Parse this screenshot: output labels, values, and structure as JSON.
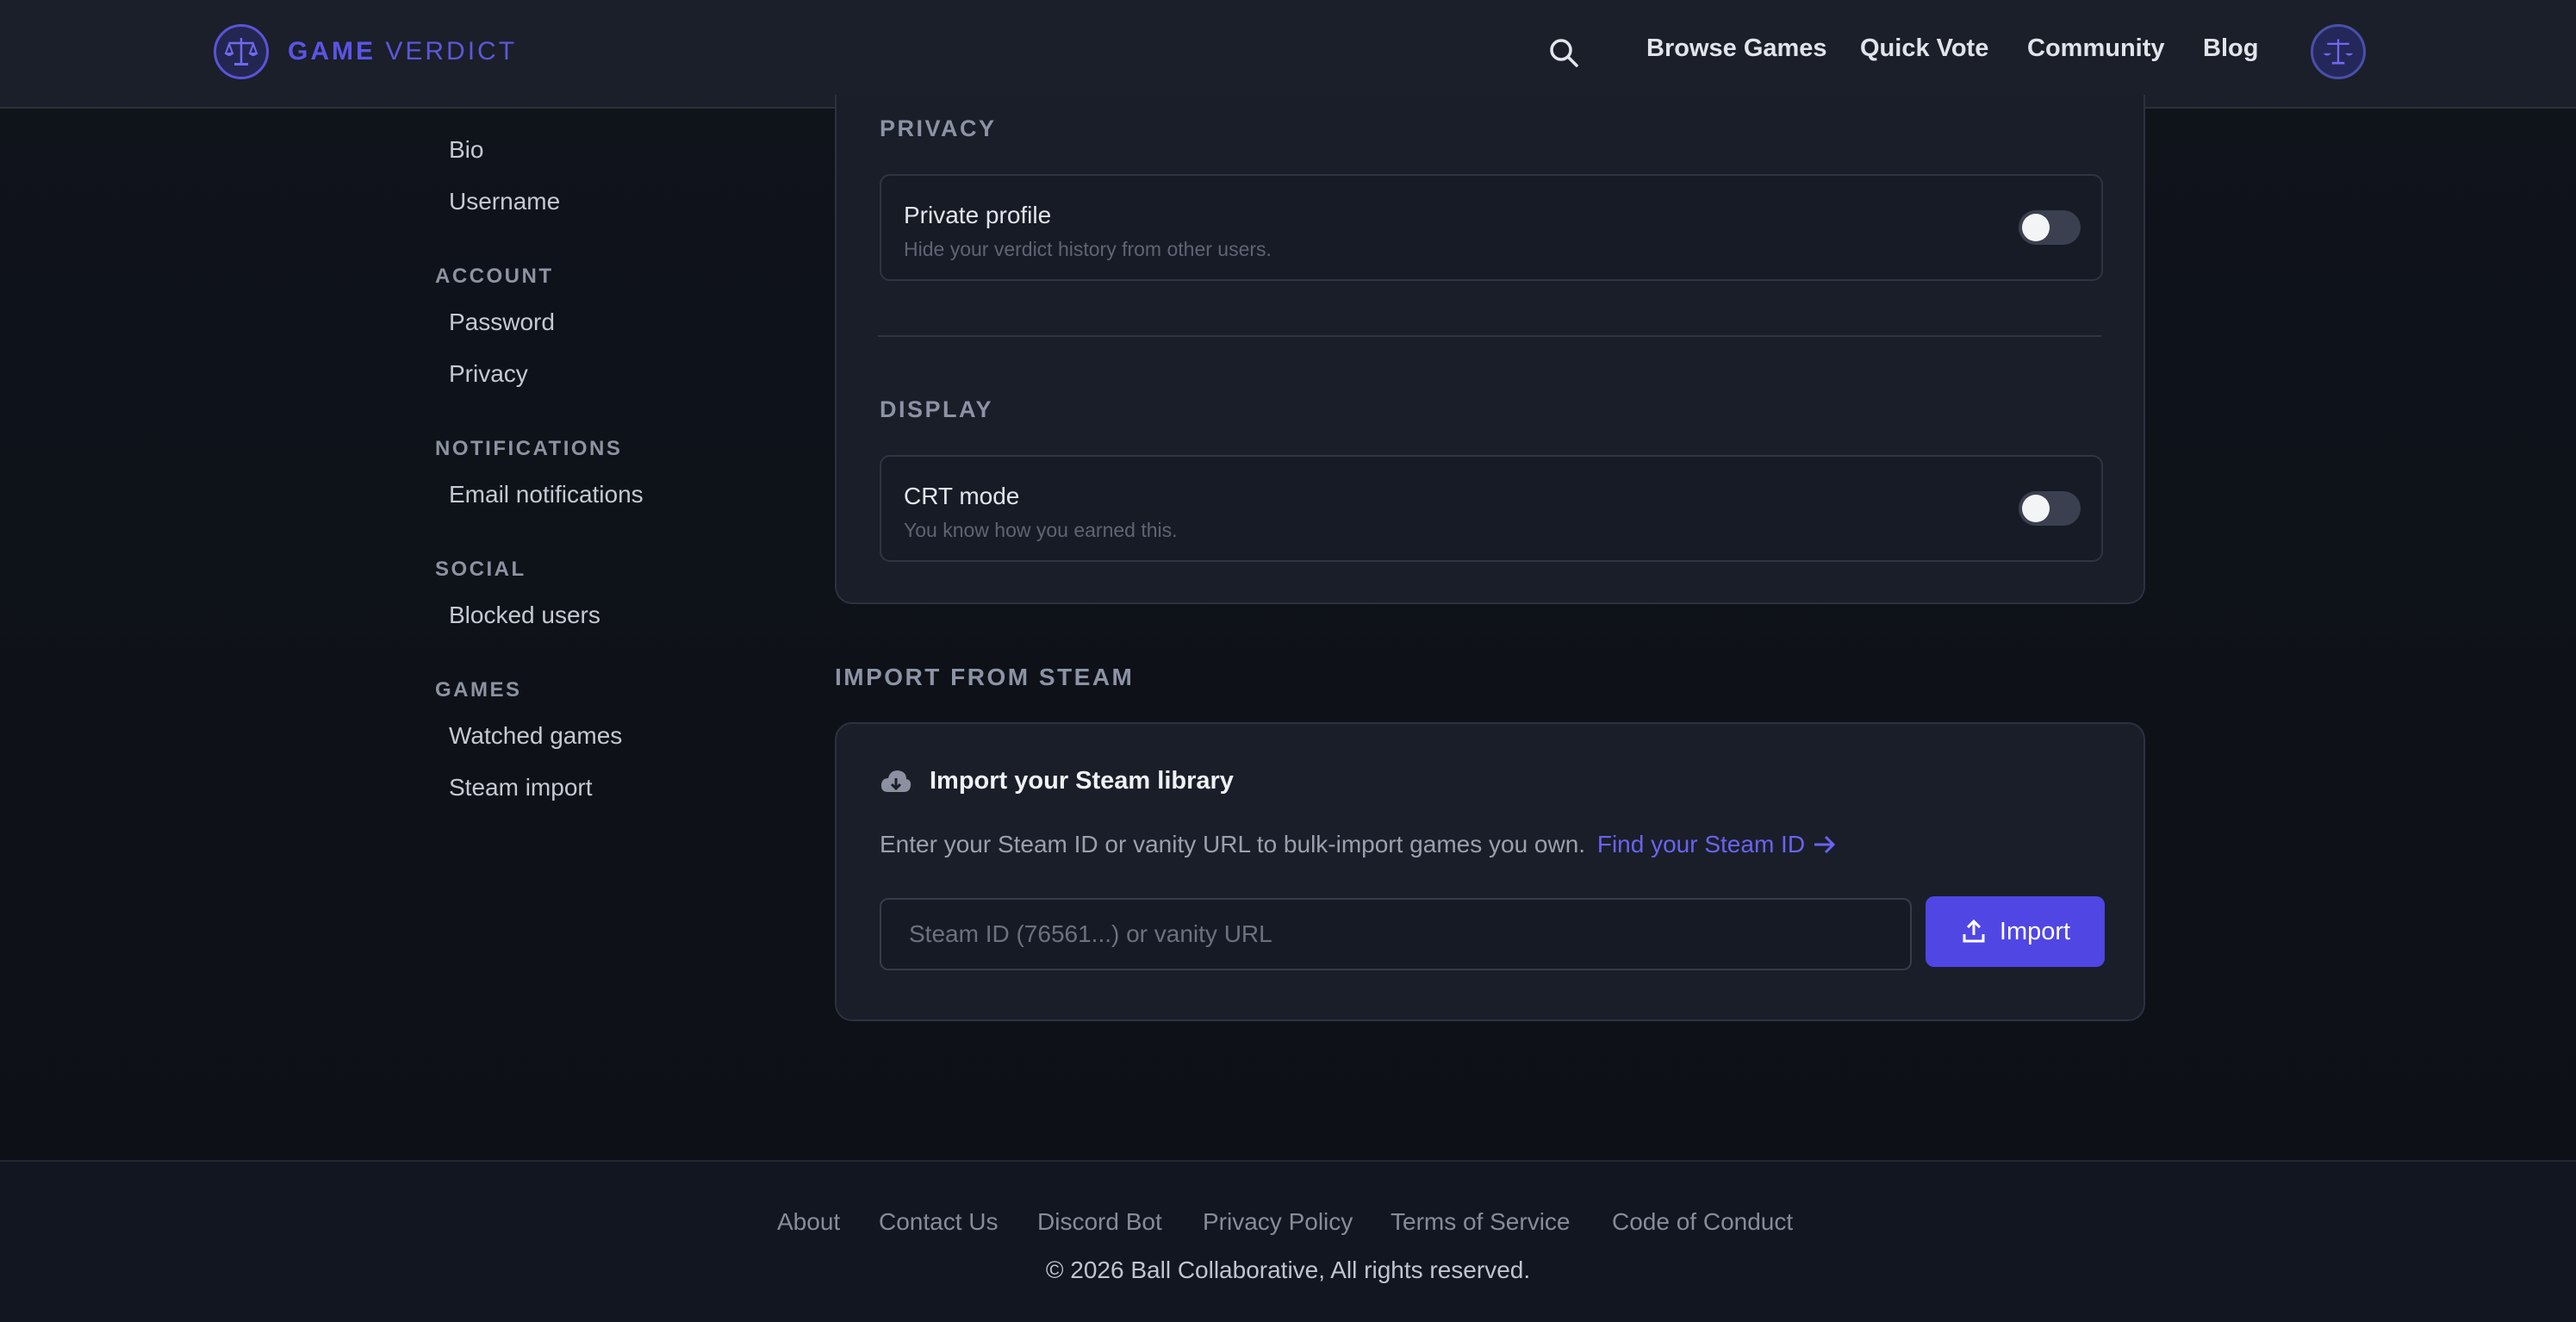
{
  "header": {
    "logo_bold": "GAME",
    "logo_light": "VERDICT",
    "nav": [
      "Browse Games",
      "Quick Vote",
      "Community",
      "Blog"
    ]
  },
  "sidebar": {
    "profile_items": [
      "Bio",
      "Username"
    ],
    "groups": [
      {
        "title": "ACCOUNT",
        "items": [
          "Password",
          "Privacy"
        ]
      },
      {
        "title": "NOTIFICATIONS",
        "items": [
          "Email notifications"
        ]
      },
      {
        "title": "SOCIAL",
        "items": [
          "Blocked users"
        ]
      },
      {
        "title": "GAMES",
        "items": [
          "Watched games",
          "Steam import"
        ]
      }
    ]
  },
  "privacy": {
    "section_title": "PRIVACY",
    "setting_title": "Private profile",
    "setting_desc": "Hide your verdict history from other users.",
    "enabled": false
  },
  "display": {
    "section_title": "DISPLAY",
    "setting_title": "CRT mode",
    "setting_desc": "You know how you earned this.",
    "enabled": false
  },
  "steam_import": {
    "heading": "IMPORT FROM STEAM",
    "title": "Import your Steam library",
    "description": "Enter your Steam ID or vanity URL to bulk-import games you own.",
    "link_text": "Find your Steam ID",
    "input_placeholder": "Steam ID (76561...) or vanity URL",
    "input_value": "",
    "button_label": "Import"
  },
  "footer": {
    "links": [
      "About",
      "Contact Us",
      "Discord Bot",
      "Privacy Policy",
      "Terms of Service",
      "Code of Conduct"
    ],
    "copyright": "© 2026 Ball Collaborative, All rights reserved."
  },
  "colors": {
    "accent": "#5046e4",
    "link": "#6a63f0",
    "background": "#0e1118",
    "card": "#1a1e29"
  }
}
